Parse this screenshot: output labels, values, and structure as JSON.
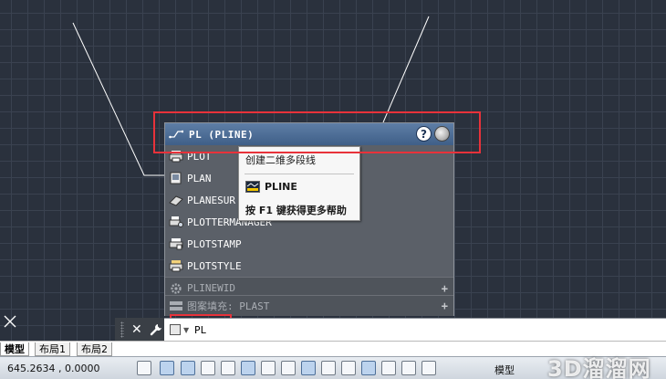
{
  "autocomplete": {
    "header": {
      "title": "PL (PLINE)",
      "icon": "polyline-icon",
      "help_label": "?",
      "help_icon": "help-icon",
      "globe_icon": "globe-icon"
    },
    "items": [
      {
        "label": "PLOT",
        "icon": "printer-icon"
      },
      {
        "label": "PLAN",
        "icon": "plan-icon"
      },
      {
        "label": "PLANESUR",
        "icon": "planesurf-icon"
      },
      {
        "label": "PLOTTERMANAGER",
        "icon": "plotter-manager-icon"
      },
      {
        "label": "PLOTSTAMP",
        "icon": "plotstamp-icon"
      },
      {
        "label": "PLOTSTYLE",
        "icon": "plotstyle-icon"
      }
    ],
    "groups": [
      {
        "label": "PLINEWID",
        "icon": "gear-icon",
        "expand": "+"
      },
      {
        "label": "图案填充: PLAST",
        "icon": "hatch-icon",
        "expand": "+"
      }
    ]
  },
  "tooltip": {
    "description": "创建二维多段线",
    "command": "PLINE",
    "command_icon": "pline-command-icon",
    "hint": "按 F1 键获得更多帮助"
  },
  "command_line": {
    "close_label": "✕",
    "wrench_icon": "wrench-icon",
    "value": "PL"
  },
  "tabs": [
    {
      "label": "模型",
      "active": true
    },
    {
      "label": "布局1",
      "active": false
    },
    {
      "label": "布局2",
      "active": false
    }
  ],
  "status_bar": {
    "coordinates": "645.2634 , 0.0000",
    "model_label": "模型"
  },
  "watermark": "3D溜溜网",
  "colors": {
    "canvas_bg": "#2a313d",
    "highlight_red": "#e8323a",
    "header_blue": "#4f6f97"
  }
}
